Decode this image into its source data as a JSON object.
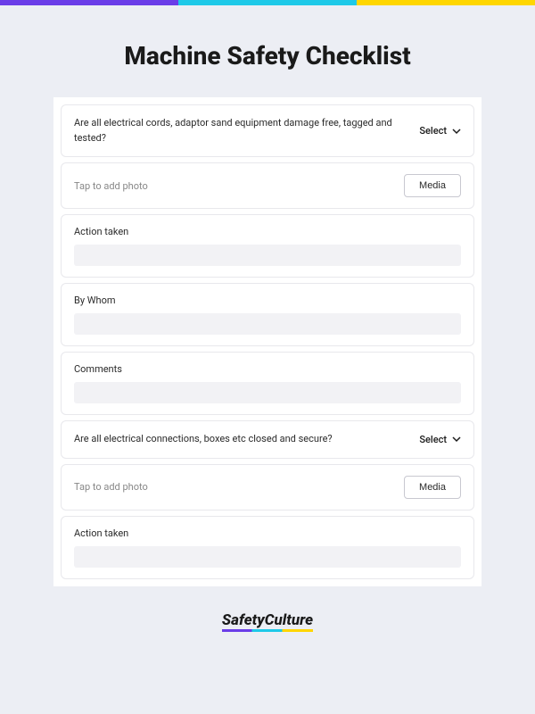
{
  "title": "Machine Safety Checklist",
  "selectLabel": "Select",
  "mediaPlaceholder": "Tap to add photo",
  "mediaButtonLabel": "Media",
  "questions": [
    {
      "text": "Are all electrical cords, adaptor sand equipment damage free, tagged and tested?"
    },
    {
      "text": "Are all electrical connections, boxes etc closed and secure?"
    }
  ],
  "fields": {
    "actionTakenLabel": "Action taken",
    "byWhomLabel": "By Whom",
    "commentsLabel": "Comments"
  },
  "brand": "SafetyCulture"
}
